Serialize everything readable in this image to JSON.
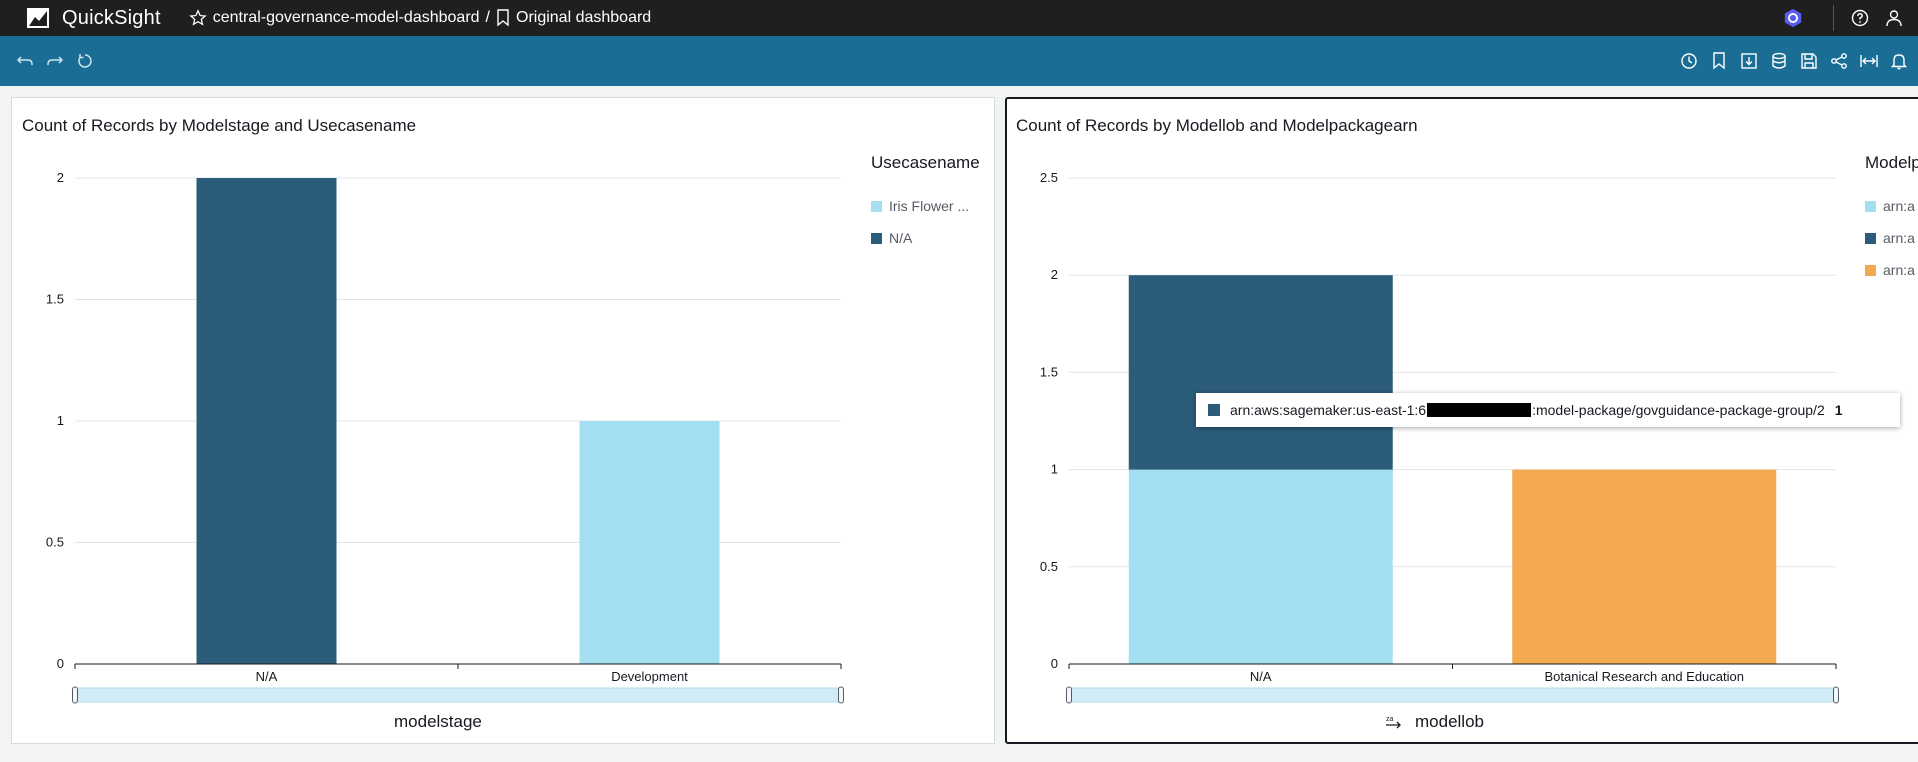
{
  "header": {
    "app_name": "QuickSight",
    "dashboard_name": "central-governance-model-dashboard",
    "separator": "/",
    "view_name": "Original dashboard"
  },
  "toolbar": {
    "left_icons": [
      "undo-icon",
      "redo-icon",
      "reset-icon"
    ],
    "right_icons": [
      "schedule-icon",
      "bookmark-icon",
      "download-icon",
      "data-icon",
      "save-icon",
      "share-icon",
      "fit-width-icon",
      "bell-icon"
    ]
  },
  "colors": {
    "light_blue": "#a3dff0",
    "dark_blue": "#2b5c79",
    "orange": "#f2a950",
    "toolbar": "#1a6e96",
    "topbar": "#1f1f1f"
  },
  "chart_data": [
    {
      "type": "bar",
      "title": "Count of Records by Modelstage and Usecasename",
      "xlabel": "modelstage",
      "legend_title": "Usecasename",
      "categories": [
        "N/A",
        "Development"
      ],
      "series": [
        {
          "name": "Iris Flower ...",
          "values": [
            0,
            1
          ],
          "color": "#a3dff0"
        },
        {
          "name": "N/A",
          "values": [
            2,
            0
          ],
          "color": "#2b5c79"
        }
      ],
      "yticks": [
        "0",
        "0.5",
        "1",
        "1.5",
        "2"
      ],
      "ylim": [
        0,
        2
      ],
      "grid": true,
      "legend": "right"
    },
    {
      "type": "bar",
      "stacked": true,
      "title": "Count of Records by Modellob and Modelpackagearn",
      "xlabel": "modellob",
      "legend_title": "Modelp",
      "categories": [
        "N/A",
        "Botanical Research and Education"
      ],
      "series": [
        {
          "name": "arn:a",
          "values": [
            1,
            0
          ],
          "color": "#a3dff0"
        },
        {
          "name": "arn:a",
          "values": [
            1,
            0
          ],
          "color": "#2b5c79"
        },
        {
          "name": "arn:a",
          "values": [
            0,
            1
          ],
          "color": "#f2a950"
        }
      ],
      "yticks": [
        "0",
        "0.5",
        "1",
        "1.5",
        "2",
        "2.5"
      ],
      "ylim": [
        0,
        2.5
      ],
      "grid": true,
      "legend": "right"
    }
  ],
  "tooltip": {
    "text_before": "arn:aws:sagemaker:us-east-1:6",
    "text_after": ":model-package/govguidance-package-group/2",
    "value": "1"
  }
}
